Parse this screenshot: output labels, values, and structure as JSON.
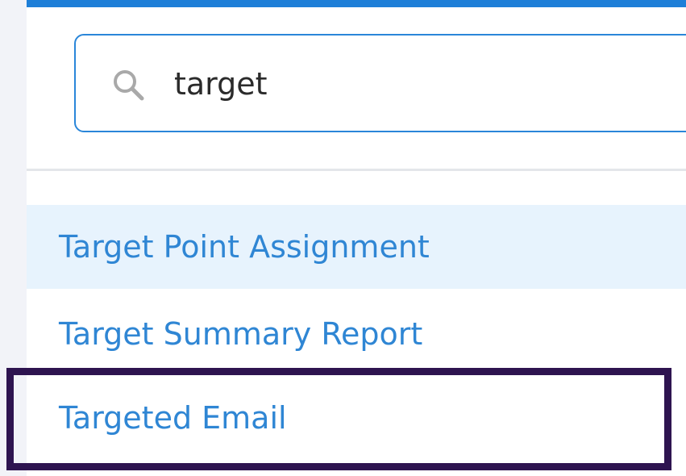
{
  "search": {
    "value": "target",
    "icon": "search-icon"
  },
  "results": [
    {
      "label": "Target Point Assignment",
      "highlighted": true
    },
    {
      "label": "Target Summary Report",
      "highlighted": false
    },
    {
      "label": "Targeted Email",
      "highlighted": false
    }
  ],
  "colors": {
    "accent": "#1e7fd8",
    "link": "#2f86d4",
    "active_row_bg": "#e7f3fd",
    "annotation_border": "#2e1450"
  }
}
